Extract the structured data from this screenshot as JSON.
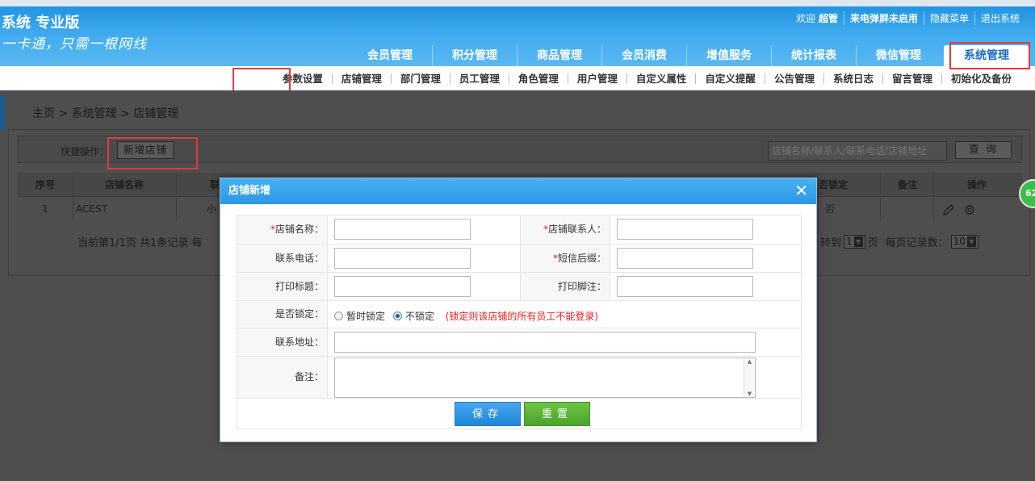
{
  "header": {
    "brand": "系统 专业版",
    "slogan": "一卡通，只需一根网线",
    "userbar": {
      "welcome": "欢迎",
      "user": "超管",
      "popup": "来电弹屏未启用",
      "hide_menu": "隐藏菜单",
      "logout": "退出系统"
    },
    "main_nav": [
      "会员管理",
      "积分管理",
      "商品管理",
      "会员消费",
      "增值服务",
      "统计报表",
      "微信管理",
      "系统管理"
    ],
    "active_main": "系统管理"
  },
  "sub_nav": [
    "参数设置",
    "店铺管理",
    "部门管理",
    "员工管理",
    "角色管理",
    "用户管理",
    "自定义属性",
    "自定义提醒",
    "公告管理",
    "系统日志",
    "留言管理",
    "初始化及备份"
  ],
  "breadcrumb": "主页 > 系统管理 > 店铺管理",
  "quick": {
    "label": "快捷操作：",
    "add_button": "新增店铺",
    "search_placeholder": "店铺名称/联系人/联系电话/店铺地址",
    "search_button": "查 询"
  },
  "table": {
    "headers": {
      "seq": "序号",
      "name": "店铺名称",
      "contact_partial": "联",
      "locked_partial": "否锁定",
      "remark": "备注",
      "actions": "操作"
    },
    "rows": [
      {
        "seq": "1",
        "name": "ACEST",
        "contact_partial": "小",
        "locked": "否"
      }
    ]
  },
  "pager": {
    "summary": "当前第1/1页 共1条记录 每",
    "goto_label": "转到",
    "page_value": "1",
    "page_suffix": "页",
    "per_page_label": "每页记录数：",
    "per_page_value": "10"
  },
  "badge": "62",
  "modal": {
    "title": "店铺新增",
    "close": "✕",
    "fields": {
      "store_name": {
        "required": "*",
        "label": "店铺名称："
      },
      "store_contact": {
        "required": "*",
        "label": "店铺联系人："
      },
      "phone": {
        "label": "联系电话："
      },
      "sms_suffix": {
        "required": "*",
        "label": "短信后缀："
      },
      "print_title": {
        "label": "打印标题："
      },
      "print_footer": {
        "label": "打印脚注："
      },
      "lock": {
        "label": "是否锁定：",
        "option_temp": "暂时锁定",
        "option_unlocked": "不锁定",
        "selected": "不锁定",
        "hint": "(锁定则该店铺的所有员工不能登录)"
      },
      "address": {
        "label": "联系地址："
      },
      "remark": {
        "label": "备注："
      }
    },
    "save": "保存",
    "reset": "重置"
  },
  "colors": {
    "accent": "#2a97e6",
    "highlight_box": "#e23b3b",
    "save": "#1f86d8",
    "reset": "#4aa32b"
  }
}
